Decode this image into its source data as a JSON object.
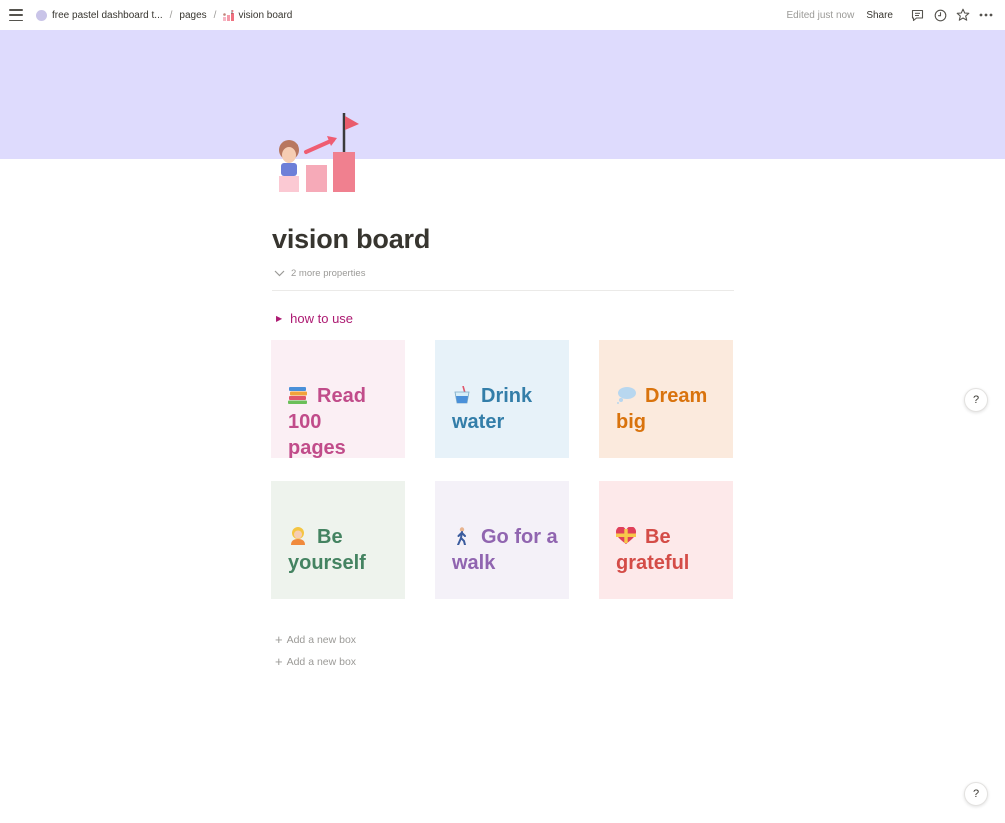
{
  "topbar": {
    "breadcrumbs": [
      "free pastel dashboard t...",
      "pages",
      "vision board"
    ],
    "separator": "/",
    "edited": "Edited just now",
    "share": "Share"
  },
  "page": {
    "title": "vision board",
    "properties_toggle": "2 more properties",
    "toggle_label": "how to use"
  },
  "cards": [
    {
      "emoji": "books",
      "line1": "Read 100",
      "line2": "pages",
      "bg": "#fbeff4",
      "fg": "#c14c8a"
    },
    {
      "emoji": "cup-with-straw",
      "line1": "Drink",
      "line2": "water",
      "bg": "#e7f2f9",
      "fg": "#337ea9"
    },
    {
      "emoji": "thought-balloon",
      "line1": "Dream",
      "line2": "big",
      "bg": "#fbeadd",
      "fg": "#d9730d"
    },
    {
      "emoji": "person-blond",
      "line1": "Be",
      "line2": "yourself",
      "bg": "#eef3ed",
      "fg": "#448361"
    },
    {
      "emoji": "person-walking",
      "line1": "Go for a",
      "line2": "walk",
      "bg": "#f4f1f8",
      "fg": "#9065b0"
    },
    {
      "emoji": "heart-with-ribbon",
      "line1": "Be",
      "line2": "grateful",
      "bg": "#fde9ea",
      "fg": "#d44c47"
    }
  ],
  "add_new": [
    "Add a new box",
    "Add a new box"
  ],
  "help": "?",
  "colors": {
    "cover": "#dedbfd",
    "toggle": "#ad1a72",
    "muted": "#9b9a97"
  }
}
